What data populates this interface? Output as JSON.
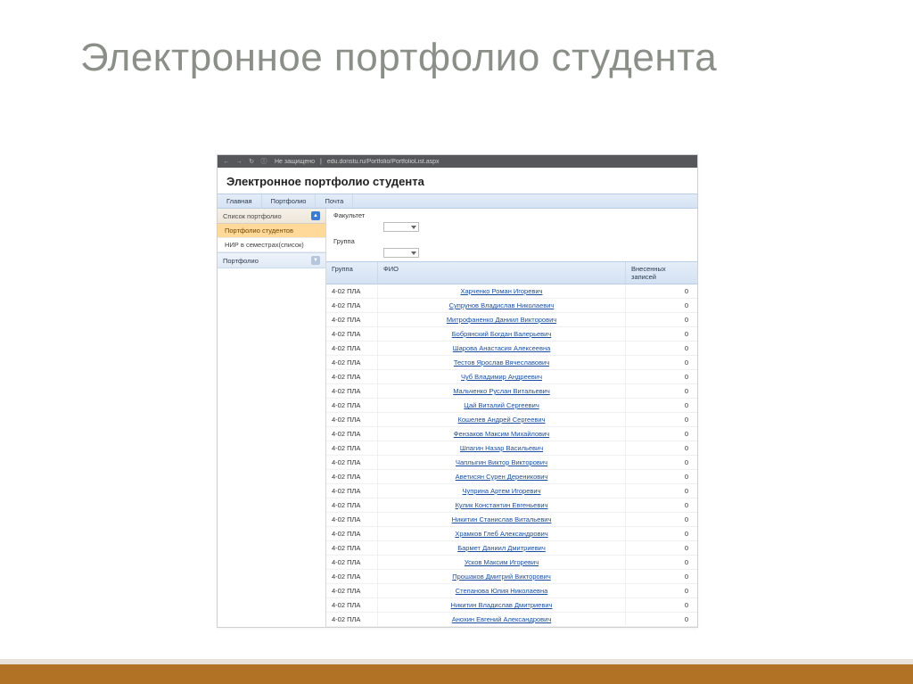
{
  "slide_title": "Электронное портфолио студента",
  "browser": {
    "insecure_label": "Не защищено",
    "url": "edu.donstu.ru/Portfolio/PortfolioList.aspx"
  },
  "app_title": "Электронное портфолио студента",
  "top_tabs": [
    "Главная",
    "Портфолио",
    "Почта"
  ],
  "sidebar": {
    "header": "Список портфолио",
    "items": [
      {
        "label": "Портфолио студентов",
        "active": true
      },
      {
        "label": "НИР в семестрах(список)",
        "active": false
      }
    ],
    "footer": "Портфолио"
  },
  "filters": {
    "faculty_label": "Факультет",
    "group_label": "Группа"
  },
  "grid": {
    "headers": {
      "group": "Группа",
      "fio": "ФИО",
      "count": "Внесенных записей"
    },
    "rows": [
      {
        "group": "4-02 ПЛА",
        "fio": "Харченко Роман Игоревич",
        "count": "0"
      },
      {
        "group": "4-02 ПЛА",
        "fio": "Супрунов Владислав Николаевич",
        "count": "0"
      },
      {
        "group": "4-02 ПЛА",
        "fio": "Митрофаненко Даниил Викторович",
        "count": "0"
      },
      {
        "group": "4-02 ПЛА",
        "fio": "Бобрянский Богдан Валерьевич",
        "count": "0"
      },
      {
        "group": "4-02 ПЛА",
        "fio": "Шарова Анастасия Алексеевна",
        "count": "0"
      },
      {
        "group": "4-02 ПЛА",
        "fio": "Тестов Ярослав Вячеславович",
        "count": "0"
      },
      {
        "group": "4-02 ПЛА",
        "fio": "Чуб Владимир Андреевич",
        "count": "0"
      },
      {
        "group": "4-02 ПЛА",
        "fio": "Мальченко Руслан Витальевич",
        "count": "0"
      },
      {
        "group": "4-02 ПЛА",
        "fio": "Цай Виталий Сергеевич",
        "count": "0"
      },
      {
        "group": "4-02 ПЛА",
        "fio": "Кошелев Андрей Сергеевич",
        "count": "0"
      },
      {
        "group": "4-02 ПЛА",
        "fio": "Фензаков Максим Михайлович",
        "count": "0"
      },
      {
        "group": "4-02 ПЛА",
        "fio": "Шпагин Назар Васильевич",
        "count": "0"
      },
      {
        "group": "4-02 ПЛА",
        "fio": "Чаплыгин Виктор Викторович",
        "count": "0"
      },
      {
        "group": "4-02 ПЛА",
        "fio": "Аветисян Сурен Дереникович",
        "count": "0"
      },
      {
        "group": "4-02 ПЛА",
        "fio": "Чуприна Артем Игоревич",
        "count": "0"
      },
      {
        "group": "4-02 ПЛА",
        "fio": "Кулик Константин Евгеньевич",
        "count": "0"
      },
      {
        "group": "4-02 ПЛА",
        "fio": "Никитин Станислав Витальевич",
        "count": "0"
      },
      {
        "group": "4-02 ПЛА",
        "fio": "Храмков Глеб Александрович",
        "count": "0"
      },
      {
        "group": "4-02 ПЛА",
        "fio": "Бармет Даниил Дмитриевич",
        "count": "0"
      },
      {
        "group": "4-02 ПЛА",
        "fio": "Усков Максим Игоревич",
        "count": "0"
      },
      {
        "group": "4-02 ПЛА",
        "fio": "Прошаков Дмитрий Викторович",
        "count": "0"
      },
      {
        "group": "4-02 ПЛА",
        "fio": "Степанова Юлия Николаевна",
        "count": "0"
      },
      {
        "group": "4-02 ПЛА",
        "fio": "Никитин Владислав Дмитриевич",
        "count": "0"
      },
      {
        "group": "4-02 ПЛА",
        "fio": "Анохин Евгений Александрович",
        "count": "0"
      }
    ]
  }
}
